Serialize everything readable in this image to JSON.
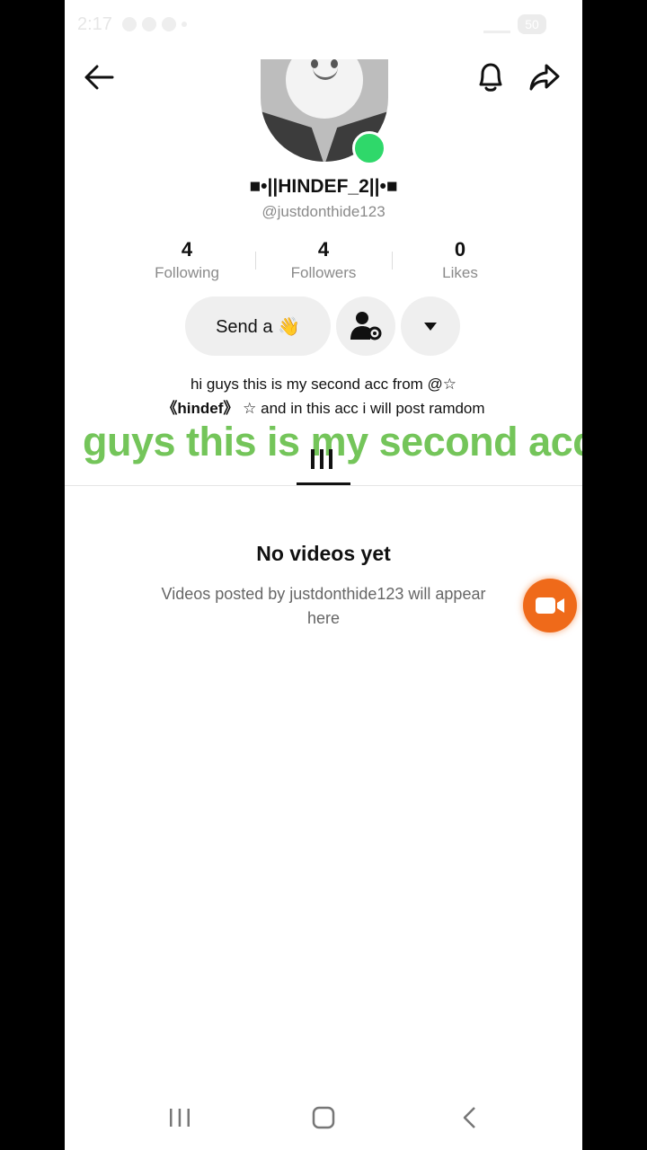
{
  "status_bar": {
    "time": "2:17",
    "battery": "50"
  },
  "profile": {
    "display_name": "■•||HINDEF_2||•■",
    "username": "@justdonthide123",
    "online": true
  },
  "stats": [
    {
      "value": "4",
      "label": "Following"
    },
    {
      "value": "4",
      "label": "Followers"
    },
    {
      "value": "0",
      "label": "Likes"
    }
  ],
  "actions": {
    "send_label": "Send a 👋"
  },
  "bio": {
    "line1": "hi guys this is my second acc from @☆",
    "line2_bold": "《hindef》",
    "line2_rest": "☆ and in this acc i will post ramdom"
  },
  "overlay_caption": "guys this is my second acc",
  "empty_state": {
    "title": "No videos yet",
    "description": "Videos posted by justdonthide123 will appear here"
  },
  "icons": [
    "back-arrow-icon",
    "bell-icon",
    "share-icon",
    "person-settings-icon",
    "dropdown-triangle-icon",
    "grid-icon",
    "video-camera-icon",
    "recents-icon",
    "home-icon",
    "nav-back-icon"
  ],
  "colors": {
    "online": "#2fd86a",
    "record_button": "#ef6a1a",
    "caption": "#74c55a"
  }
}
